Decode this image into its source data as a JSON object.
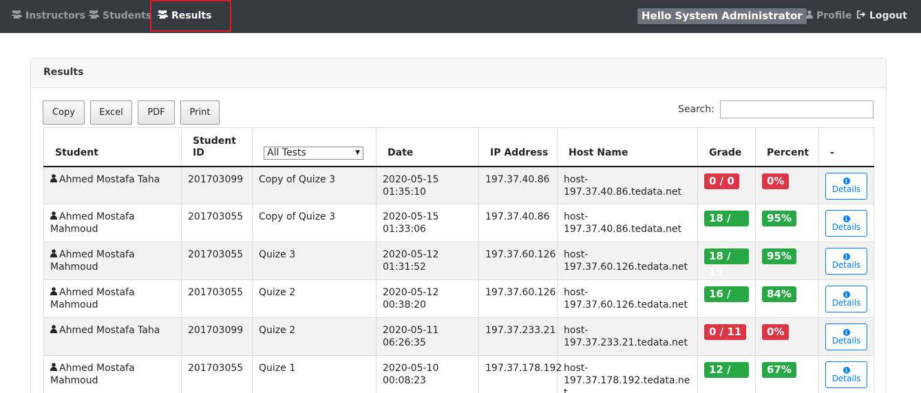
{
  "nav": {
    "instructors": "Instructors",
    "students": "Students",
    "results": "Results",
    "hello": "Hello System Administrator",
    "profile": "Profile",
    "logout": "Logout"
  },
  "card": {
    "title": "Results"
  },
  "toolbar": {
    "copy": "Copy",
    "excel": "Excel",
    "pdf": "PDF",
    "print": "Print",
    "search_label": "Search:",
    "search_value": ""
  },
  "table": {
    "headers": {
      "student": "Student",
      "student_id": "Student ID",
      "test_filter": "All Tests",
      "date": "Date",
      "ip": "IP Address",
      "host": "Host Name",
      "grade": "Grade",
      "percent": "Percent",
      "action": "-"
    },
    "rows": [
      {
        "student": "Ahmed Mostafa Taha",
        "id": "201703099",
        "test": "Copy of Quize 3",
        "date": "2020-05-15 01:35:10",
        "ip": "197.37.40.86",
        "host": "host-197.37.40.86.tedata.net",
        "grade": "0 / 0",
        "percent": "0%",
        "status": "fail",
        "action": "Details"
      },
      {
        "student": "Ahmed Mostafa Mahmoud",
        "id": "201703055",
        "test": "Copy of Quize 3",
        "date": "2020-05-15 01:33:06",
        "ip": "197.37.40.86",
        "host": "host-197.37.40.86.tedata.net",
        "grade": "18 / 19",
        "percent": "95%",
        "status": "pass",
        "action": "Details"
      },
      {
        "student": "Ahmed Mostafa Mahmoud",
        "id": "201703055",
        "test": "Quize 3",
        "date": "2020-05-12 01:31:52",
        "ip": "197.37.60.126",
        "host": "host-197.37.60.126.tedata.net",
        "grade": "18 / 19",
        "percent": "95%",
        "status": "pass",
        "action": "Details"
      },
      {
        "student": "Ahmed Mostafa Mahmoud",
        "id": "201703055",
        "test": "Quize 2",
        "date": "2020-05-12 00:38:20",
        "ip": "197.37.60.126",
        "host": "host-197.37.60.126.tedata.net",
        "grade": "16 / 19",
        "percent": "84%",
        "status": "pass",
        "action": "Details"
      },
      {
        "student": "Ahmed Mostafa Taha",
        "id": "201703099",
        "test": "Quize 2",
        "date": "2020-05-11 06:26:35",
        "ip": "197.37.233.21",
        "host": "host-197.37.233.21.tedata.net",
        "grade": "0 / 11",
        "percent": "0%",
        "status": "fail",
        "action": "Details"
      },
      {
        "student": "Ahmed Mostafa Mahmoud",
        "id": "201703055",
        "test": "Quize 1",
        "date": "2020-05-10 00:08:23",
        "ip": "197.37.178.192",
        "host": "host-197.37.178.192.tedata.net",
        "grade": "12 / 18",
        "percent": "67%",
        "status": "pass",
        "action": "Details"
      }
    ]
  },
  "colors": {
    "navbar": "#343a40",
    "success": "#28a745",
    "danger": "#dc3545",
    "primary": "#007bff",
    "highlight": "#e01b24"
  },
  "icons": {
    "nav": "users-icon",
    "profile": "user-icon",
    "logout": "sign-out-icon",
    "student": "user-icon",
    "details": "info-circle-icon"
  }
}
